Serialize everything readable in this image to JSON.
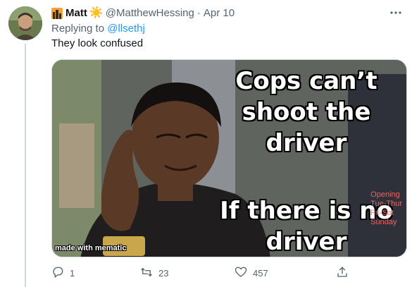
{
  "tweet": {
    "author_name": "Matt",
    "author_emoji": "☀️",
    "handle": "@MatthewHessing",
    "separator": "·",
    "date": "Apr 10",
    "replying_prefix": "Replying to",
    "replying_handle": "@llsethj",
    "text": "They look confused",
    "more_icon": "more-icon"
  },
  "media": {
    "top_text_line1": "Cops can’t",
    "top_text_line2": "shoot the",
    "top_text_line3": "driver",
    "bottom_text_line1": "If there is no",
    "bottom_text_line2": "driver",
    "watermark": "made with mematic",
    "neon_line1": "Opening",
    "neon_line2": "Tue-Thur",
    "neon_line3": "Fri-Sat",
    "neon_line4": "Sunday"
  },
  "actions": {
    "reply_count": "1",
    "retweet_count": "23",
    "like_count": "457",
    "share_label": ""
  },
  "icons": {
    "reply": "reply-icon",
    "retweet": "retweet-icon",
    "like": "heart-icon",
    "share": "share-icon"
  },
  "colors": {
    "link": "#1d9bf0",
    "secondary_text": "#536471",
    "thread_line": "#cfd9de"
  }
}
